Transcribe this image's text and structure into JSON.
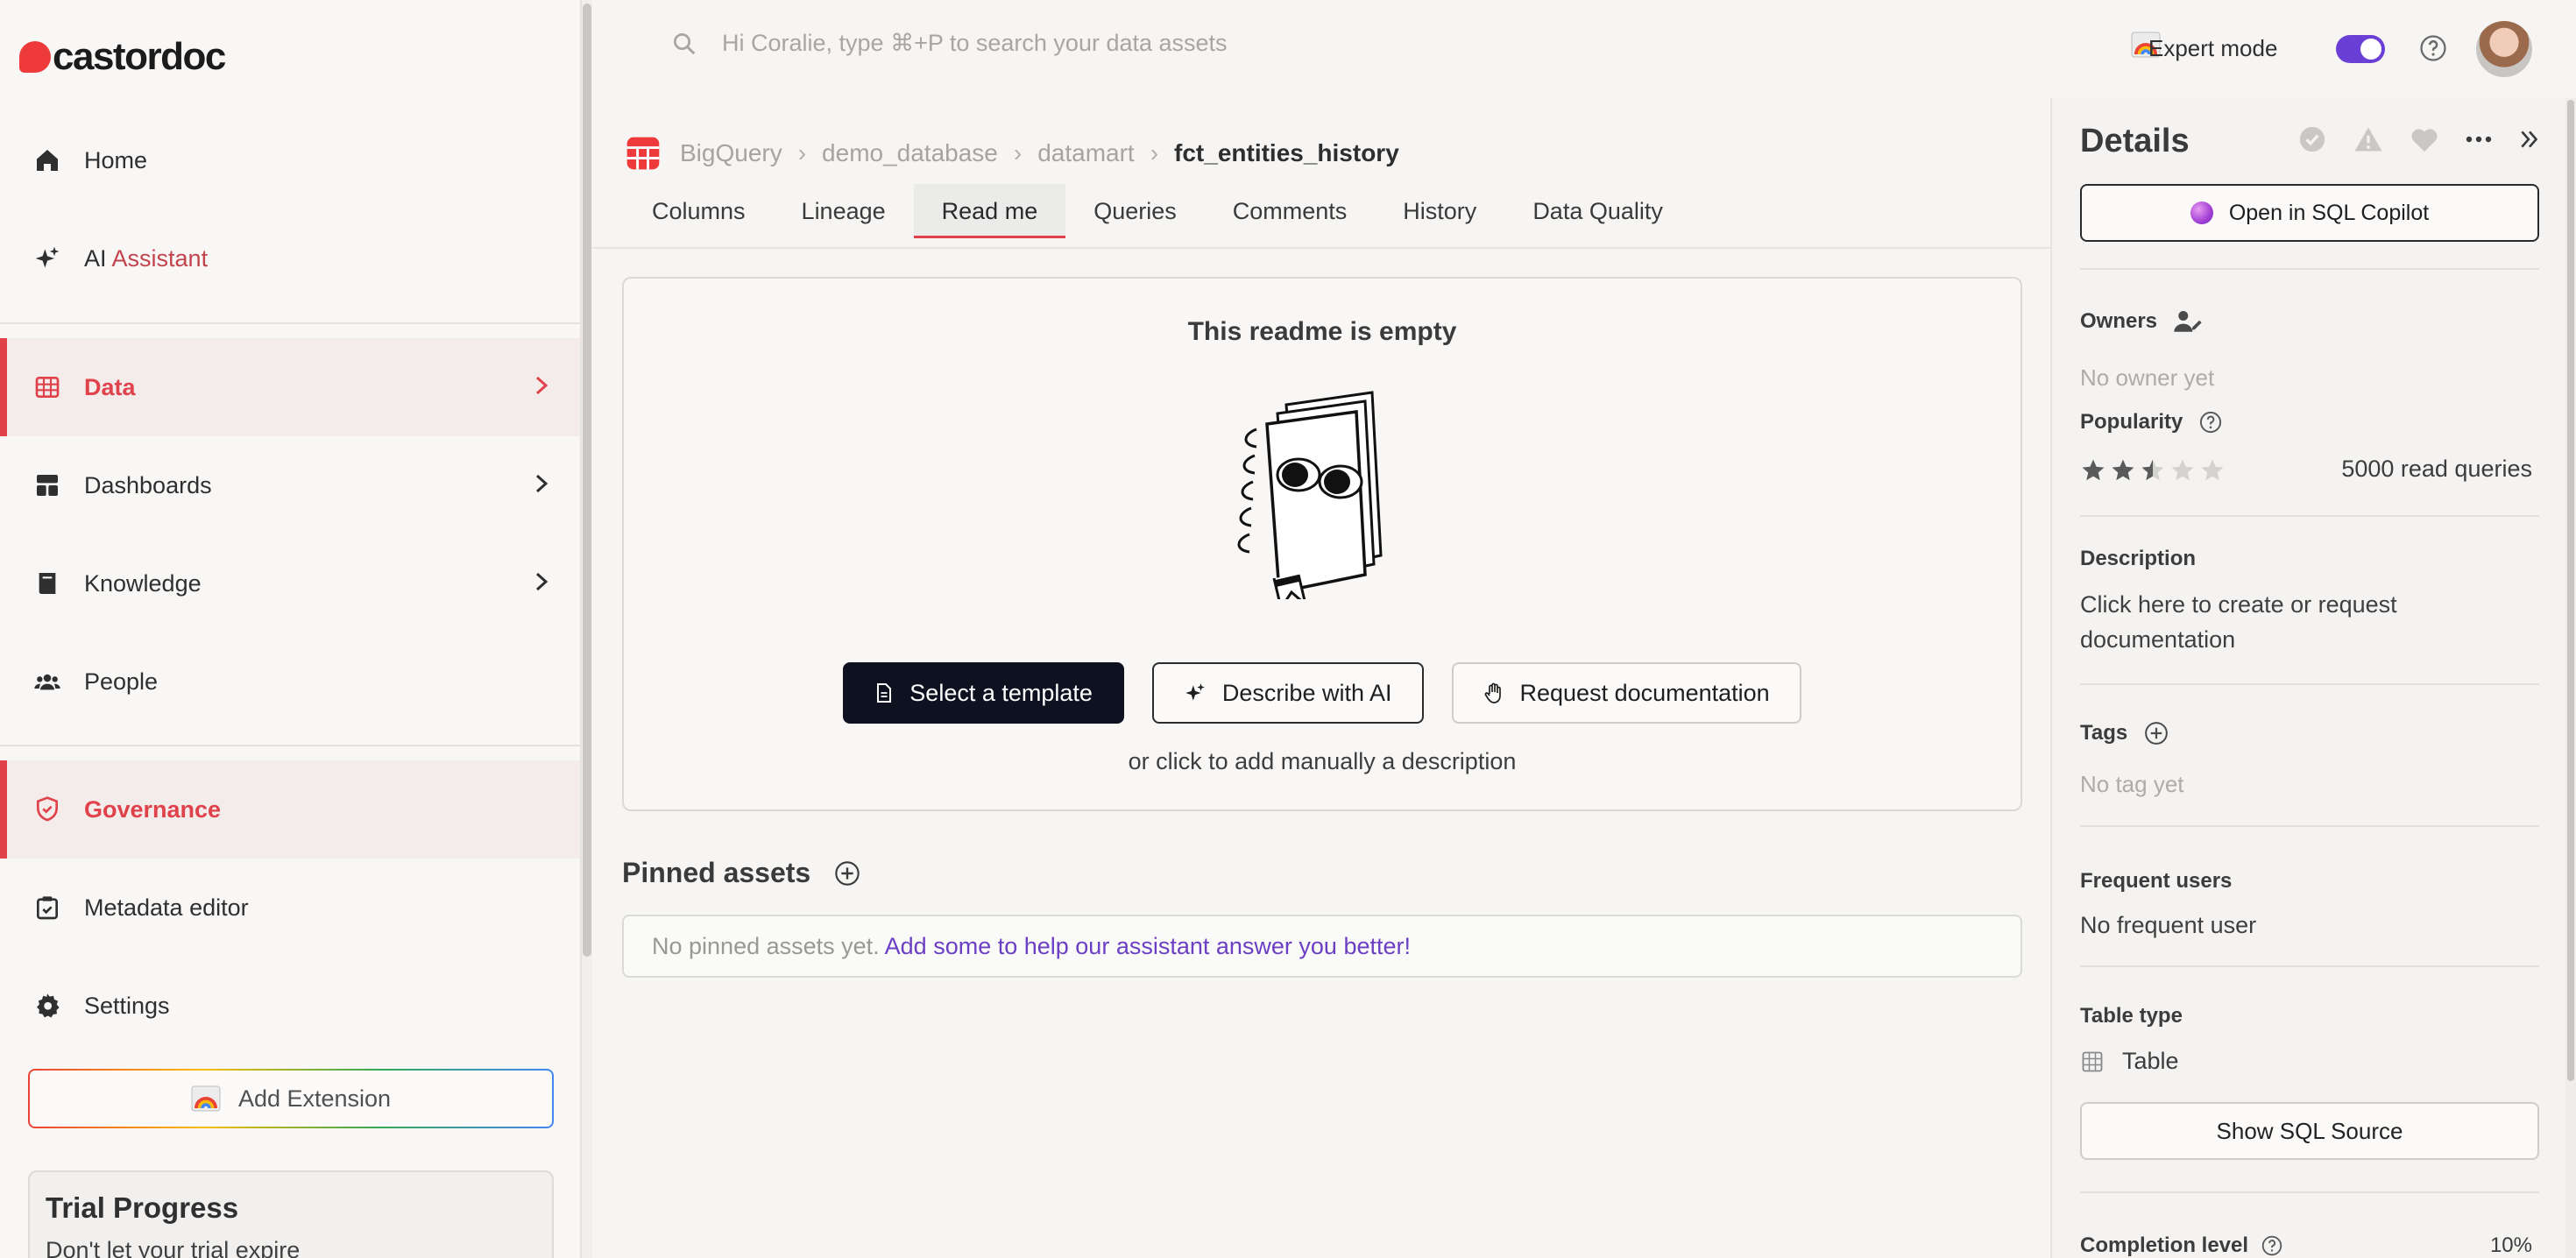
{
  "brand": {
    "name": "castordoc",
    "color": "#ee3a3a"
  },
  "sidebar": {
    "items": [
      {
        "label": "Home",
        "icon": "home-icon"
      },
      {
        "label_main": "AI ",
        "label_accent": "Assistant",
        "icon": "sparkle-icon"
      },
      {
        "label": "Data",
        "icon": "grid-table-icon",
        "active": true
      },
      {
        "label": "Dashboards",
        "icon": "dashboard-icon"
      },
      {
        "label": "Knowledge",
        "icon": "book-icon"
      },
      {
        "label": "People",
        "icon": "people-icon"
      },
      {
        "label": "Governance",
        "icon": "shield-check-icon",
        "active": true
      },
      {
        "label": "Metadata editor",
        "icon": "clipboard-check-icon"
      },
      {
        "label": "Settings",
        "icon": "gear-icon"
      }
    ],
    "add_extension": "Add Extension",
    "trial": {
      "title": "Trial Progress",
      "subtitle": "Don't let your trial expire"
    }
  },
  "topbar": {
    "search_placeholder": "Hi Coralie, type ⌘+P to search your data assets",
    "expert_mode_label": "Expert mode",
    "expert_mode_on": true
  },
  "breadcrumb": [
    "BigQuery",
    "demo_database",
    "datamart",
    "fct_entities_history"
  ],
  "tabs": [
    "Columns",
    "Lineage",
    "Read me",
    "Queries",
    "Comments",
    "History",
    "Data Quality"
  ],
  "active_tab": "Read me",
  "readme": {
    "title": "This readme is empty",
    "buttons": {
      "template": "Select a template",
      "describe_ai": "Describe with AI",
      "request_doc": "Request documentation"
    },
    "hint": "or click to add manually a description"
  },
  "pinned": {
    "title": "Pinned assets",
    "empty_text": "No pinned assets yet.",
    "link_text": "Add some to help our assistant answer you better!"
  },
  "details": {
    "title": "Details",
    "open_copilot": "Open in SQL Copilot",
    "owners_label": "Owners",
    "owners_value": "No owner yet",
    "popularity_label": "Popularity",
    "popularity_stars": 2.5,
    "popularity_max": 5,
    "read_queries": "5000 read queries",
    "description_label": "Description",
    "description_value": "Click here to create or request documentation",
    "tags_label": "Tags",
    "tags_value": "No tag yet",
    "frequent_users_label": "Frequent users",
    "frequent_users_value": "No frequent user",
    "table_type_label": "Table type",
    "table_type_value": "Table",
    "show_sql": "Show SQL Source",
    "completion_label": "Completion level",
    "completion_value": "10%"
  },
  "colors": {
    "accent": "#e0424c",
    "toggle": "#6a3fd6",
    "link": "#6b3fc4",
    "dark_button": "#0e1220"
  }
}
